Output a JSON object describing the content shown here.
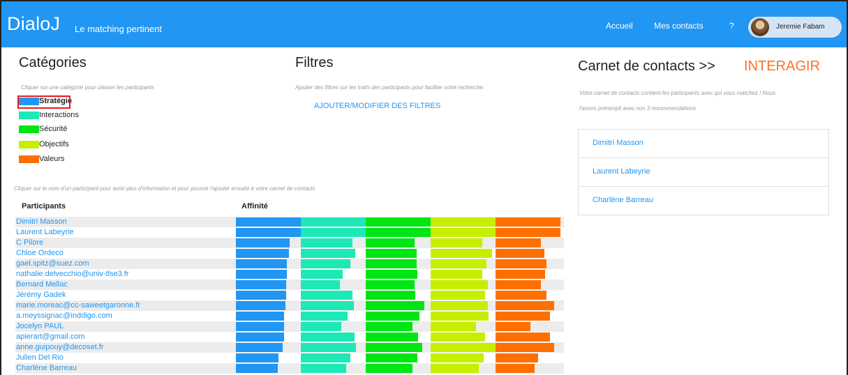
{
  "header": {
    "brand": "DialoJ",
    "tagline": "Le matching pertinent",
    "nav": {
      "home": "Accueil",
      "contacts": "Mes contacts",
      "help": "?"
    },
    "user": "Jeremie Fabam",
    "color": "#2196f3"
  },
  "categories": {
    "title": "Catégories",
    "hint": "Cliquer sur une catégorie pour classer les participants",
    "items": [
      {
        "label": "Stratégie",
        "color": "#2196f3",
        "selected": true
      },
      {
        "label": "Interactions",
        "color": "#1de9b6",
        "selected": false
      },
      {
        "label": "Sécurité",
        "color": "#00e514",
        "selected": false
      },
      {
        "label": "Objectifs",
        "color": "#c6ef00",
        "selected": false
      },
      {
        "label": "Valeurs",
        "color": "#ff6f00",
        "selected": false
      }
    ]
  },
  "filters": {
    "title": "Filtres",
    "hint": "Ajouter des filtres sur les traits des participants pour faciliter votre recherche.",
    "link": "AJOUTER/MODIFIER DES FILTRES"
  },
  "participants_hint": "Cliquer sur le nom d'un participant pour avoir plus d'information et pour pouvoir l'ajouter ensuite à votre carnet de contacts",
  "table": {
    "col_participants": "Participants",
    "col_affinity": "Affinité",
    "rows": [
      {
        "name": "Dimitri Masson",
        "scores": [
          1.0,
          1.0,
          1.0,
          1.0,
          1.0
        ]
      },
      {
        "name": "Laurent Labeyrie",
        "scores": [
          1.0,
          1.0,
          1.0,
          1.0,
          1.0
        ]
      },
      {
        "name": "C Pilore",
        "scores": [
          0.83,
          0.8,
          0.75,
          0.8,
          0.7
        ]
      },
      {
        "name": "Chloe Ordeco",
        "scores": [
          0.82,
          0.84,
          0.78,
          0.95,
          0.75
        ]
      },
      {
        "name": "gael.spitz@suez.com",
        "scores": [
          0.79,
          0.76,
          0.78,
          0.86,
          0.79
        ]
      },
      {
        "name": "nathalie.delvecchio@univ-tlse3.fr",
        "scores": [
          0.79,
          0.64,
          0.8,
          0.8,
          0.76
        ]
      },
      {
        "name": "Bernard Mellac",
        "scores": [
          0.77,
          0.6,
          0.75,
          0.88,
          0.7
        ]
      },
      {
        "name": "Jérémy Gadek",
        "scores": [
          0.77,
          0.8,
          0.76,
          0.84,
          0.78
        ]
      },
      {
        "name": "marie.moreac@cc-saweetgaronne.fr",
        "scores": [
          0.76,
          0.82,
          0.9,
          0.88,
          0.9
        ]
      },
      {
        "name": "a.meyssignac@inddigo.com",
        "scores": [
          0.74,
          0.72,
          0.83,
          0.89,
          0.84
        ]
      },
      {
        "name": "Jocelyn PAUL",
        "scores": [
          0.74,
          0.62,
          0.72,
          0.7,
          0.54
        ]
      },
      {
        "name": "apierart@gmail.com",
        "scores": [
          0.74,
          0.83,
          0.81,
          0.84,
          0.84
        ]
      },
      {
        "name": "anne.guipouy@decoset.fr",
        "scores": [
          0.72,
          0.85,
          0.87,
          1.0,
          0.9
        ]
      },
      {
        "name": "Julien Del Rio",
        "scores": [
          0.66,
          0.76,
          0.8,
          0.82,
          0.66
        ]
      },
      {
        "name": "Charlène Barreau",
        "scores": [
          0.64,
          0.7,
          0.72,
          0.74,
          0.6
        ]
      }
    ]
  },
  "contacts": {
    "title": "Carnet de contacts >>",
    "action": "INTERAGIR",
    "action_color": "#ff6f22",
    "hint1": "Votre carnet de contacts contient les participants avec qui vous matchez ! Nous",
    "hint2": "l'avons prérempli avec nos 3 recommendations",
    "items": [
      "Dimitri Masson",
      "Laurent Labeyrie",
      "Charlène Barreau"
    ]
  }
}
